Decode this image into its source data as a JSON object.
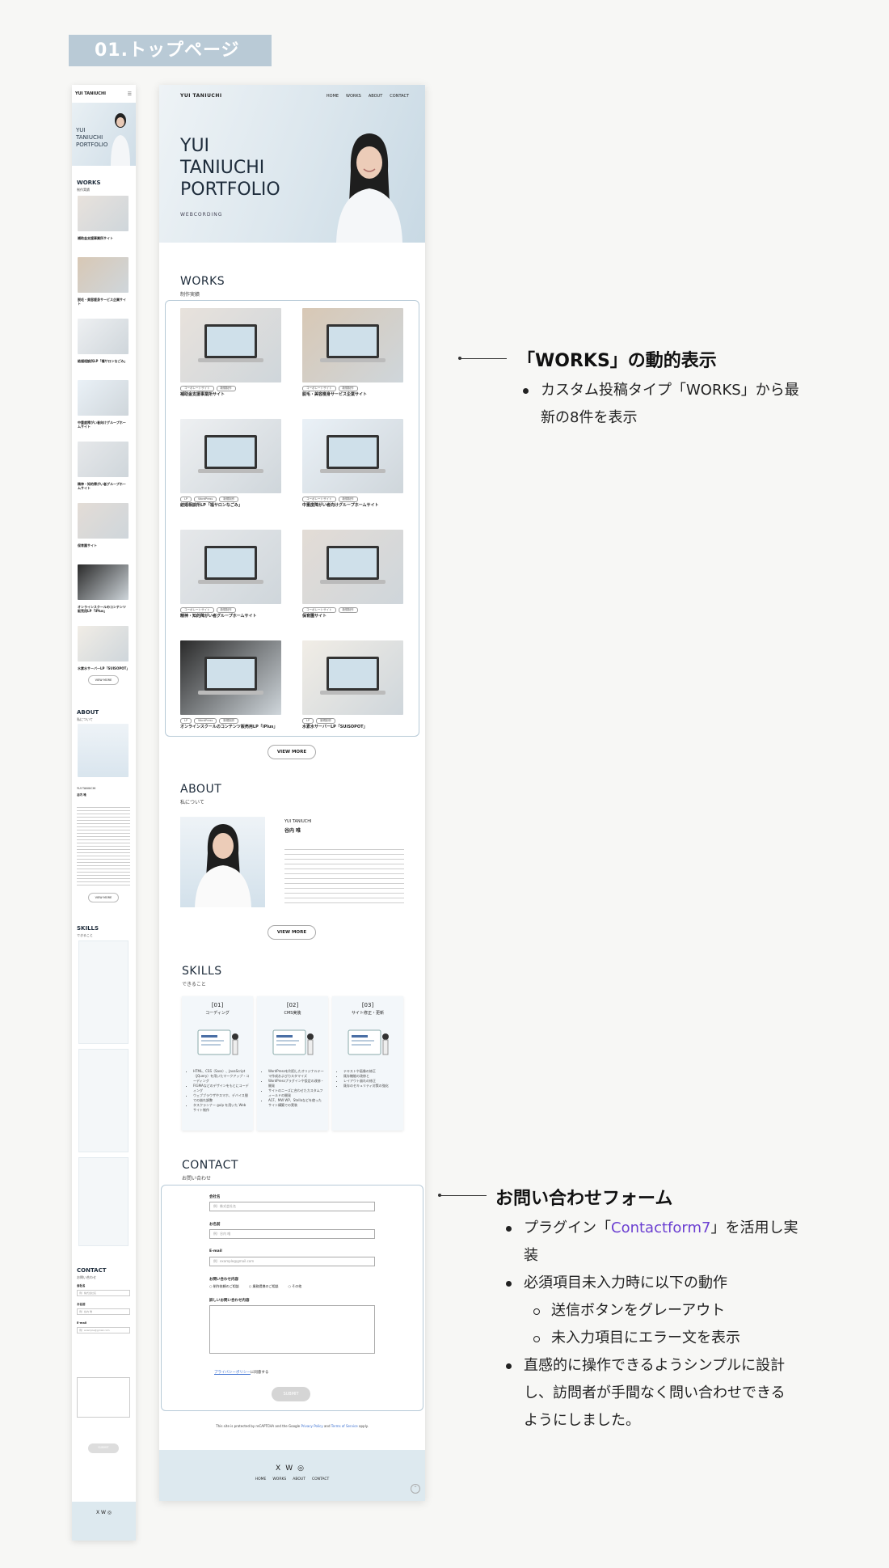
{
  "page_title": "01.トップページ",
  "site": {
    "logo": "YUI TANIUCHI",
    "nav": [
      "HOME",
      "WORKS",
      "ABOUT",
      "CONTACT"
    ],
    "hero_title": "YUI\nTANIUCHI\nPORTFOLIO",
    "hero_subtitle": "WEBCORDING",
    "works": {
      "title": "WORKS",
      "subtitle": "制作実績",
      "items": [
        {
          "title": "補助金支援事業所サイト",
          "tags": [
            "コーポレートサイト",
            "新規制作"
          ]
        },
        {
          "title": "脱毛・美容痩身サービス企業サイト",
          "tags": [
            "コーポレートサイト",
            "新規制作"
          ]
        },
        {
          "title": "結婚相談所LP「福サロンなごみ」",
          "tags": [
            "LP",
            "WordPress",
            "新規制作"
          ]
        },
        {
          "title": "中重度障がい者向けグループホームサイト",
          "tags": [
            "コーポレートサイト",
            "新規制作"
          ]
        },
        {
          "title": "精神・知的障がい者グループホームサイト",
          "tags": [
            "コーポレートサイト",
            "新規制作"
          ]
        },
        {
          "title": "保育園サイト",
          "tags": [
            "コーポレートサイト",
            "新規制作"
          ]
        },
        {
          "title": "オンラインスクールのコンテンツ販売用LP「iPlus」",
          "tags": [
            "LP",
            "WordPress",
            "新規制作"
          ]
        },
        {
          "title": "水素水サーバーLP「SUISOPOT」",
          "tags": [
            "LP",
            "新規制作"
          ]
        }
      ],
      "view_more": "VIEW MORE"
    },
    "about": {
      "title": "ABOUT",
      "subtitle": "私について",
      "name_en": "YUI TANIUCHI",
      "name_ja": "谷内 唯",
      "view_more": "VIEW MORE"
    },
    "skills": {
      "title": "SKILLS",
      "subtitle": "できること",
      "cards": [
        {
          "num": "[01]",
          "name": "コーディング",
          "items": [
            "HTML、CSS（Sass）、JavaScript（jQuery）を用いたマークアップ・コーディング",
            "FIGMAなどのデザインをもとにコーディング",
            "ウェブブラウザやスマホ、デバイス間での崩れ調整",
            "タスクランナー gulp を用いた Web サイト制作"
          ]
        },
        {
          "num": "[02]",
          "name": "CMS実装",
          "items": [
            "WordPressを利用したオリジナルテーマ作成およびカスタマイズ",
            "WordPressプラグインや設定の改修・開発",
            "サイトのニーズに合わせたカスタムフィールドの開発",
            "ACF、MW WP、Stellaなどを使ったサイト構築での実装"
          ]
        },
        {
          "num": "[03]",
          "name": "サイト修正・更新",
          "items": [
            "テキストや画像の修正",
            "既存機能の改修と",
            "レイアウト崩れの修正",
            "既存のセキュリティ対策の強化"
          ]
        }
      ]
    },
    "contact": {
      "title": "CONTACT",
      "subtitle": "お問い合わせ",
      "fields": [
        {
          "label": "会社名",
          "placeholder": "例）株式会社名"
        },
        {
          "label": "お名前",
          "placeholder": "例）谷内 唯"
        },
        {
          "label": "E-mail",
          "placeholder": "例）example@gmail.com"
        }
      ],
      "inquiry_label": "お問い合わせ内容",
      "inquiry_options": [
        "制作依頼のご相談",
        "業務提携のご相談",
        "その他"
      ],
      "message_label": "詳しいお問い合わせ内容",
      "privacy_link": "プライバシーポリシー",
      "privacy_suffix": "に同意する",
      "submit": "SUBMIT",
      "recaptcha_pre": "This site is protected by reCAPTCHA and the Google",
      "recaptcha_privacy": "Privacy Policy",
      "recaptcha_and": "and",
      "recaptcha_terms": "Terms of Service",
      "recaptcha_post": "apply."
    },
    "footer": {
      "social": [
        "X",
        "W",
        "◎"
      ],
      "nav": [
        "HOME",
        "WORKS",
        "ABOUT",
        "CONTACT"
      ]
    }
  },
  "annotations": {
    "works": {
      "heading": "「WORKS」の動的表示",
      "items": [
        "カスタム投稿タイプ「WORKS」から最新の8件を表示"
      ]
    },
    "contact": {
      "heading": "お問い合わせフォーム",
      "item1_pre": "プラグイン「",
      "item1_accent": "Contactform7",
      "item1_post": "」を活用し実装",
      "item2": "必須項目未入力時に以下の動作",
      "sub1": "送信ボタンをグレーアウト",
      "sub2": "未入力項目にエラー文を表示",
      "item3": "直感的に操作できるようシンプルに設計し、訪問者が手間なく問い合わせできるようにしました。"
    }
  },
  "colors": {
    "accent": "#6b3fd1",
    "hero": "#dbe6ed",
    "frame": "#b7cad7",
    "footer": "#dde9ef"
  }
}
